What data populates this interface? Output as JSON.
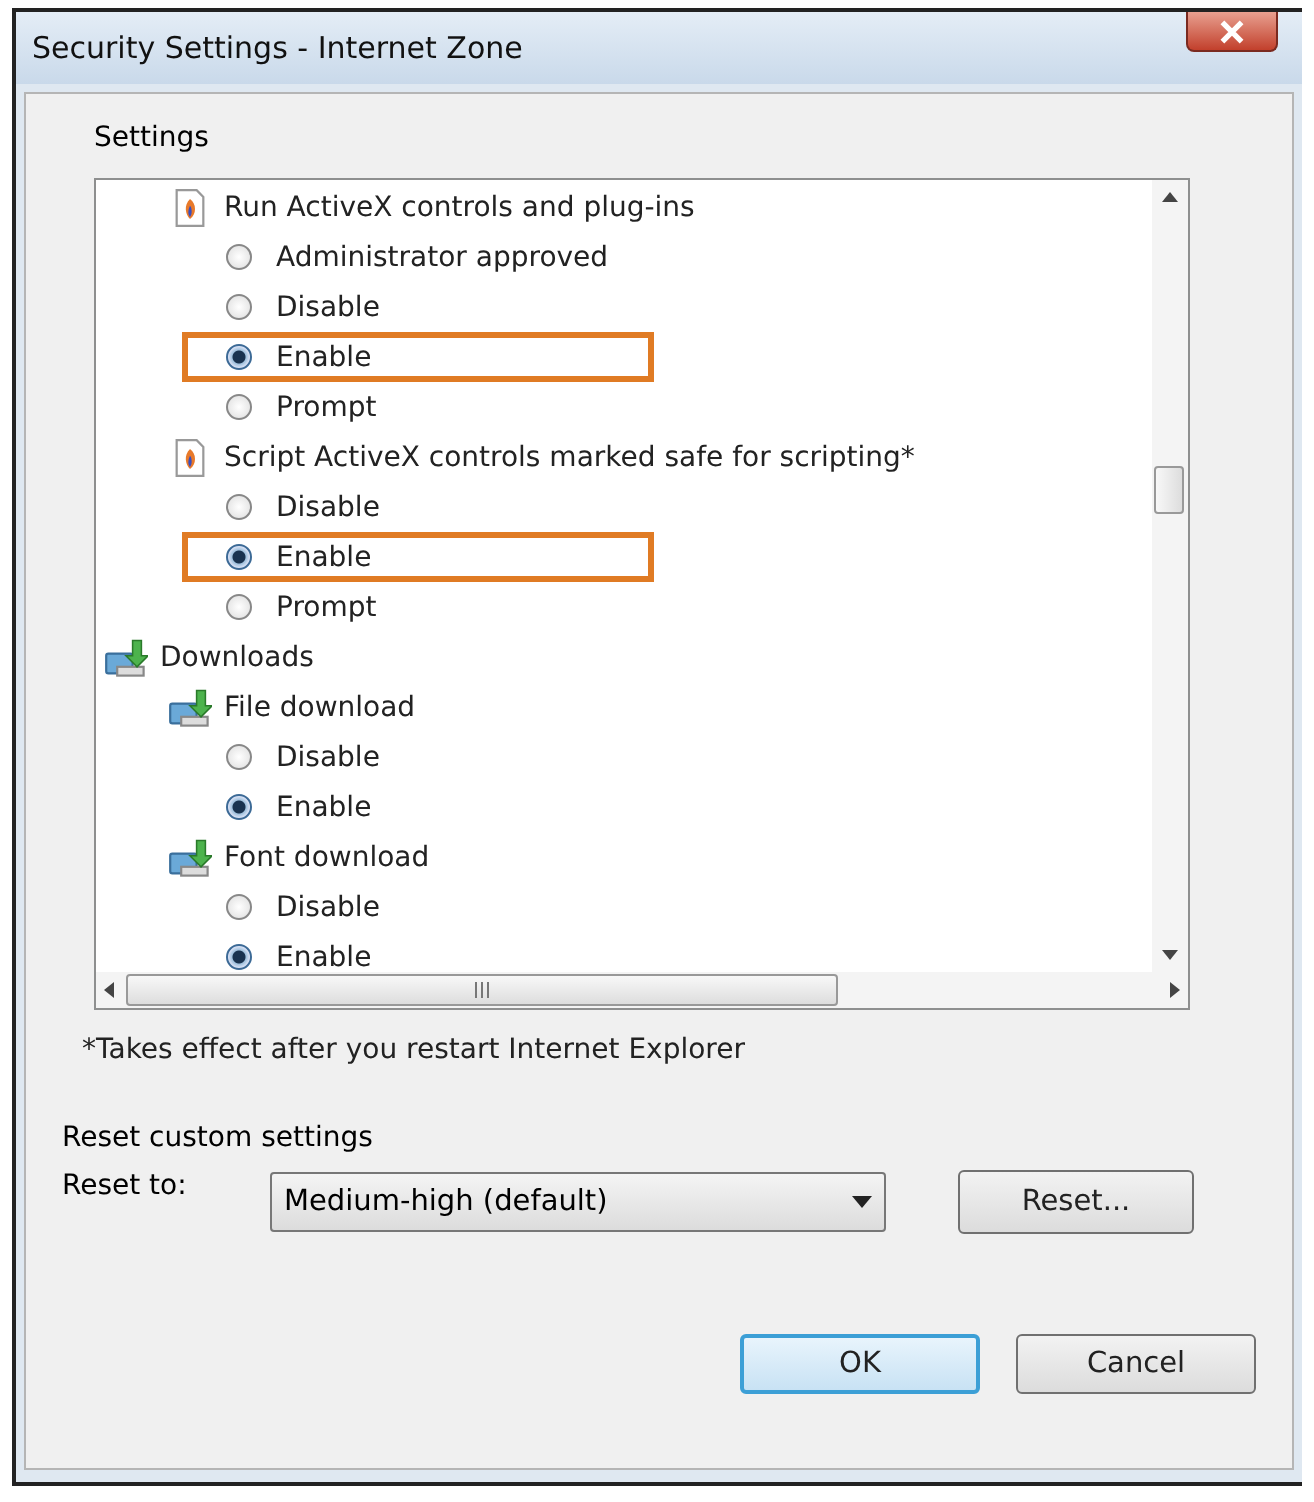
{
  "window": {
    "title": "Security Settings - Internet Zone"
  },
  "settings_label": "Settings",
  "tree": [
    {
      "kind": "setting",
      "label": "Run ActiveX controls and plug-ins",
      "children": [
        {
          "kind": "option",
          "label": "Administrator approved",
          "selected": false,
          "highlighted": false
        },
        {
          "kind": "option",
          "label": "Disable",
          "selected": false,
          "highlighted": false
        },
        {
          "kind": "option",
          "label": "Enable",
          "selected": true,
          "highlighted": true
        },
        {
          "kind": "option",
          "label": "Prompt",
          "selected": false,
          "highlighted": false
        }
      ]
    },
    {
      "kind": "setting",
      "label": "Script ActiveX controls marked safe for scripting*",
      "children": [
        {
          "kind": "option",
          "label": "Disable",
          "selected": false,
          "highlighted": false
        },
        {
          "kind": "option",
          "label": "Enable",
          "selected": true,
          "highlighted": true
        },
        {
          "kind": "option",
          "label": "Prompt",
          "selected": false,
          "highlighted": false
        }
      ]
    },
    {
      "kind": "category",
      "label": "Downloads",
      "children": [
        {
          "kind": "download",
          "label": "File download",
          "children": [
            {
              "kind": "option",
              "label": "Disable",
              "selected": false,
              "highlighted": false
            },
            {
              "kind": "option",
              "label": "Enable",
              "selected": true,
              "highlighted": false
            }
          ]
        },
        {
          "kind": "download",
          "label": "Font download",
          "children": [
            {
              "kind": "option",
              "label": "Disable",
              "selected": false,
              "highlighted": false
            },
            {
              "kind": "option",
              "label": "Enable",
              "selected": true,
              "highlighted": false
            }
          ]
        }
      ]
    }
  ],
  "footnote": "*Takes effect after you restart Internet Explorer",
  "reset": {
    "heading": "Reset custom settings",
    "label": "Reset to:",
    "value": "Medium-high (default)",
    "button": "Reset..."
  },
  "buttons": [
    {
      "label": "OK",
      "default": true
    },
    {
      "label": "Cancel",
      "default": false
    }
  ]
}
